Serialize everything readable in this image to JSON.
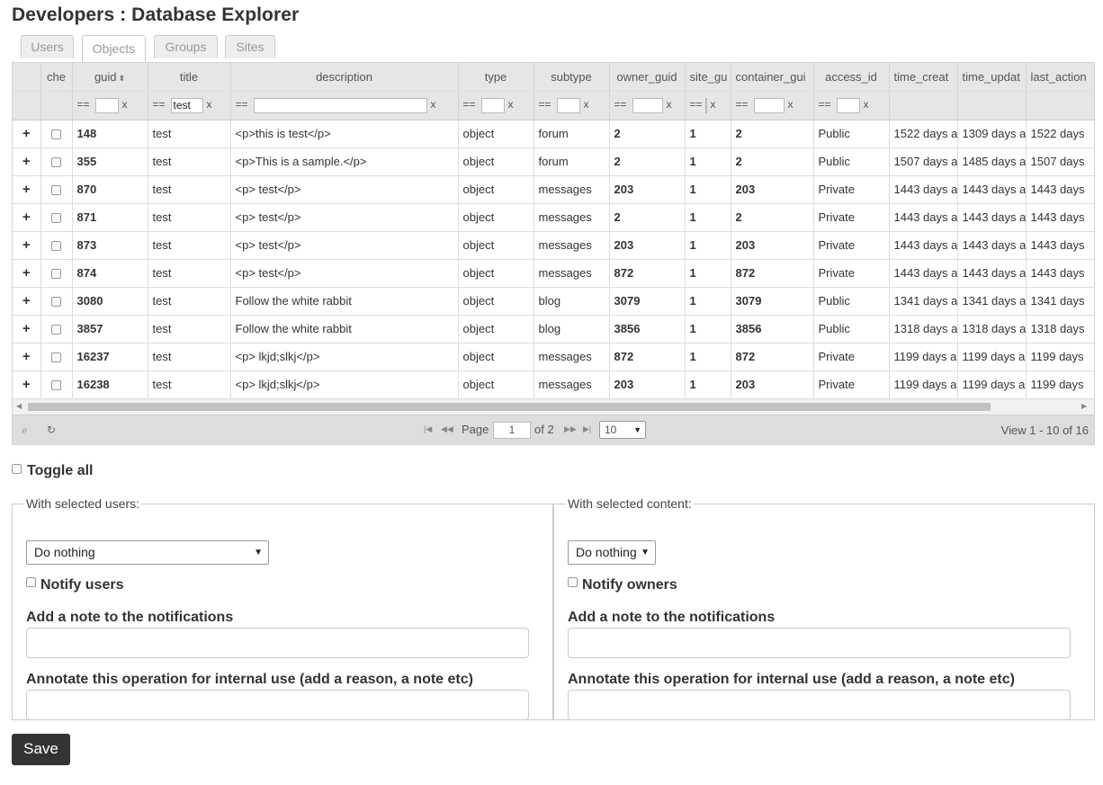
{
  "page_title": "Developers : Database Explorer",
  "tabs": [
    {
      "label": "Users",
      "active": false
    },
    {
      "label": "Objects",
      "active": true
    },
    {
      "label": "Groups",
      "active": false
    },
    {
      "label": "Sites",
      "active": false
    }
  ],
  "grid": {
    "columns": [
      "",
      "che",
      "guid",
      "title",
      "description",
      "type",
      "subtype",
      "owner_guid",
      "site_gu",
      "container_gui",
      "access_id",
      "time_creat",
      "time_updat",
      "last_action"
    ],
    "sorted_column": "guid",
    "filters": {
      "eq": "==",
      "clear": "x",
      "title_value": "test"
    },
    "rows": [
      {
        "guid": "148",
        "title": "test",
        "description": "<p>this is test</p>",
        "type": "object",
        "subtype": "forum",
        "owner_guid": "2",
        "site_guid": "1",
        "container_guid": "2",
        "access_id": "Public",
        "time_created": "1522 days a",
        "time_updated": "1309 days a",
        "last_action": "1522 days"
      },
      {
        "guid": "355",
        "title": "test",
        "description": "<p>This is a sample.</p>",
        "type": "object",
        "subtype": "forum",
        "owner_guid": "2",
        "site_guid": "1",
        "container_guid": "2",
        "access_id": "Public",
        "time_created": "1507 days a",
        "time_updated": "1485 days a",
        "last_action": "1507 days"
      },
      {
        "guid": "870",
        "title": "test",
        "description": "<p> test</p>",
        "type": "object",
        "subtype": "messages",
        "owner_guid": "203",
        "site_guid": "1",
        "container_guid": "203",
        "access_id": "Private",
        "time_created": "1443 days a",
        "time_updated": "1443 days a",
        "last_action": "1443 days"
      },
      {
        "guid": "871",
        "title": "test",
        "description": "<p> test</p>",
        "type": "object",
        "subtype": "messages",
        "owner_guid": "2",
        "site_guid": "1",
        "container_guid": "2",
        "access_id": "Private",
        "time_created": "1443 days a",
        "time_updated": "1443 days a",
        "last_action": "1443 days"
      },
      {
        "guid": "873",
        "title": "test",
        "description": "<p> test</p>",
        "type": "object",
        "subtype": "messages",
        "owner_guid": "203",
        "site_guid": "1",
        "container_guid": "203",
        "access_id": "Private",
        "time_created": "1443 days a",
        "time_updated": "1443 days a",
        "last_action": "1443 days"
      },
      {
        "guid": "874",
        "title": "test",
        "description": "<p> test</p>",
        "type": "object",
        "subtype": "messages",
        "owner_guid": "872",
        "site_guid": "1",
        "container_guid": "872",
        "access_id": "Private",
        "time_created": "1443 days a",
        "time_updated": "1443 days a",
        "last_action": "1443 days"
      },
      {
        "guid": "3080",
        "title": "test",
        "description": "Follow the white rabbit",
        "type": "object",
        "subtype": "blog",
        "owner_guid": "3079",
        "site_guid": "1",
        "container_guid": "3079",
        "access_id": "Public",
        "time_created": "1341 days a",
        "time_updated": "1341 days a",
        "last_action": "1341 days"
      },
      {
        "guid": "3857",
        "title": "test",
        "description": "Follow the white rabbit",
        "type": "object",
        "subtype": "blog",
        "owner_guid": "3856",
        "site_guid": "1",
        "container_guid": "3856",
        "access_id": "Public",
        "time_created": "1318 days a",
        "time_updated": "1318 days a",
        "last_action": "1318 days"
      },
      {
        "guid": "16237",
        "title": "test",
        "description": "<p> lkjd;slkj</p>",
        "type": "object",
        "subtype": "messages",
        "owner_guid": "872",
        "site_guid": "1",
        "container_guid": "872",
        "access_id": "Private",
        "time_created": "1199 days a",
        "time_updated": "1199 days a",
        "last_action": "1199 days"
      },
      {
        "guid": "16238",
        "title": "test",
        "description": "<p> lkjd;slkj</p>",
        "type": "object",
        "subtype": "messages",
        "owner_guid": "203",
        "site_guid": "1",
        "container_guid": "203",
        "access_id": "Private",
        "time_created": "1199 days a",
        "time_updated": "1199 days a",
        "last_action": "1199 days"
      }
    ],
    "row_expand_label": "+"
  },
  "pager": {
    "search_icon": "search-icon",
    "refresh_icon": "refresh-icon",
    "page_label": "Page",
    "page_value": "1",
    "of_label": "of 2",
    "rows_per_page": "10",
    "view_text": "View 1 - 10 of 16"
  },
  "toggle_all_label": "Toggle all",
  "users_panel": {
    "legend": "With selected users:",
    "action_value": "Do nothing",
    "notify_label": "Notify users",
    "note_label": "Add a note to the notifications",
    "annotate_label": "Annotate this operation for internal use (add a reason, a note etc)"
  },
  "content_panel": {
    "legend": "With selected content:",
    "action_value": "Do nothing",
    "notify_label": "Notify owners",
    "note_label": "Add a note to the notifications",
    "annotate_label": "Annotate this operation for internal use (add a reason, a note etc)"
  },
  "save_label": "Save"
}
